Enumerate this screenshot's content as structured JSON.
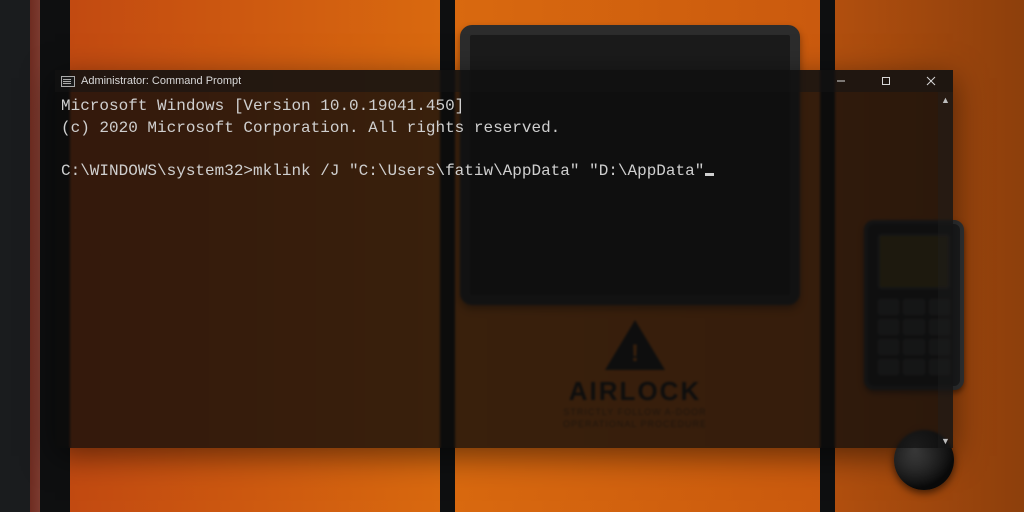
{
  "window": {
    "title": "Administrator: Command Prompt"
  },
  "terminal": {
    "line1": "Microsoft Windows [Version 10.0.19041.450]",
    "line2": "(c) 2020 Microsoft Corporation. All rights reserved.",
    "blank": "",
    "prompt": "C:\\WINDOWS\\system32>",
    "command": "mklink /J \"C:\\Users\\fatiw\\AppData\" \"D:\\AppData\""
  },
  "background": {
    "sign_title": "AIRLOCK",
    "sign_sub1": "STRICTLY FOLLOW A-DOOR",
    "sign_sub2": "OPERATIONAL PROCEDURE"
  }
}
